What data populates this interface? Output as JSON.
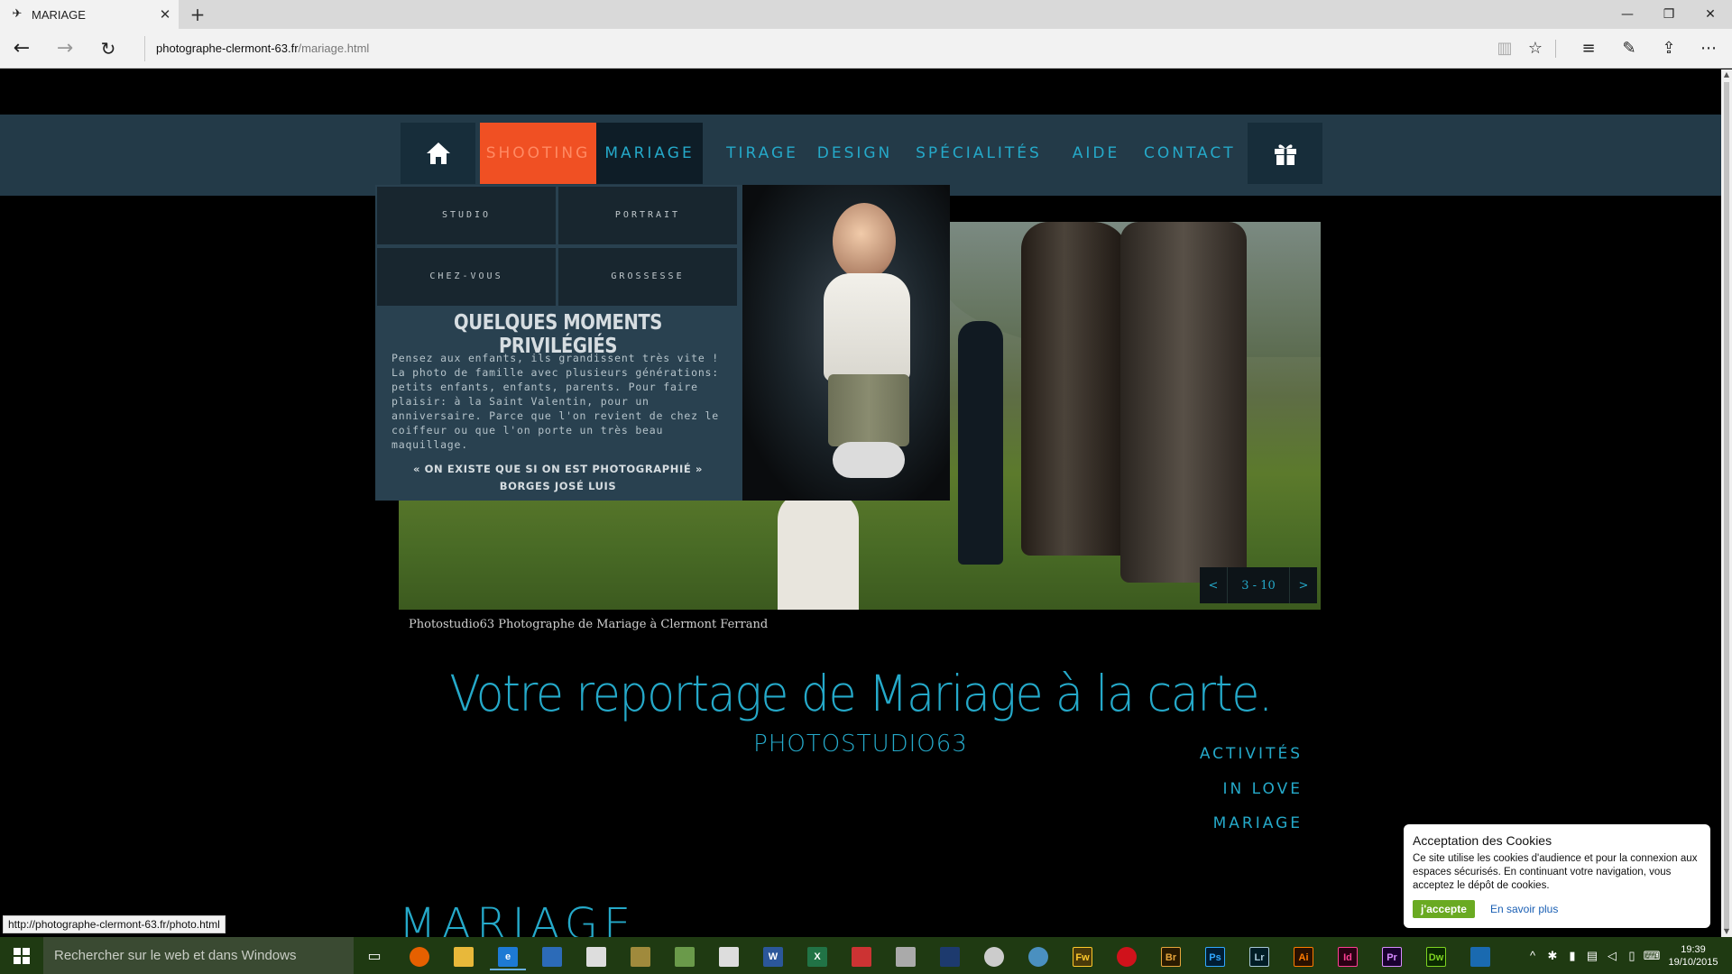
{
  "browser": {
    "tab_title": "MARIAGE",
    "tab_close": "✕",
    "new_tab": "+",
    "url_host": "photographe-clermont-63.fr",
    "url_path": "/mariage.html",
    "window_minimize": "—",
    "window_restore": "❐",
    "window_close": "✕"
  },
  "nav": {
    "home_icon": "home-icon",
    "shooting": "SHOOTING",
    "mariage": "MARIAGE",
    "tirage": "TIRAGE",
    "design": "DESIGN",
    "specialites": "SPÉCIALITÉS",
    "aide": "AIDE",
    "contact": "CONTACT",
    "gift_icon": "gift-icon"
  },
  "dropdown": {
    "items": [
      "STUDIO",
      "PORTRAIT",
      "CHEZ-VOUS",
      "GROSSESSE"
    ],
    "heading": "QUELQUES MOMENTS PRIVILÉGIÉS",
    "text": "Pensez aux enfants, ils grandissent très vite ! La photo de famille avec plusieurs générations: petits enfants, enfants, parents. Pour faire plaisir: à la Saint Valentin, pour un anniversaire. Parce que l'on revient de chez le coiffeur ou que l'on porte un très beau maquillage.",
    "quote": "« ON EXISTE QUE SI ON EST PHOTOGRAPHIÉ »",
    "quote_author": "BORGES JOSÉ LUIS"
  },
  "slider": {
    "prev": "<",
    "counter": "3 - 10",
    "next": ">",
    "caption": "Photostudio63 Photographe de Mariage  à Clermont Ferrand"
  },
  "main": {
    "headline": "Votre reportage de Mariage à la carte.",
    "subhead": "PHOTOSTUDIO63",
    "side_links": [
      "ACTIVITÉS",
      "IN LOVE",
      "MARIAGE"
    ],
    "bottom_title": "MARIAGE"
  },
  "cookie": {
    "title": "Acceptation des Cookies",
    "text": "Ce site utilise les cookies d'audience et pour la connexion aux espaces sécurisés. En continuant votre navigation, vous acceptez le dépôt de cookies.",
    "accept": "j'accepte",
    "more": "En savoir plus"
  },
  "status_url": "http://photographe-clermont-63.fr/photo.html",
  "taskbar": {
    "search_placeholder": "Rechercher sur le web et dans Windows",
    "apps": [
      "Fw",
      "Br",
      "Ps",
      "Lr",
      "Ai",
      "Id",
      "Pr",
      "Dw"
    ],
    "time": "19:39",
    "date": "19/10/2015"
  },
  "colors": {
    "accent": "#25a9c9",
    "nav_band": "#233a48",
    "shooting_active": "#f05023"
  }
}
